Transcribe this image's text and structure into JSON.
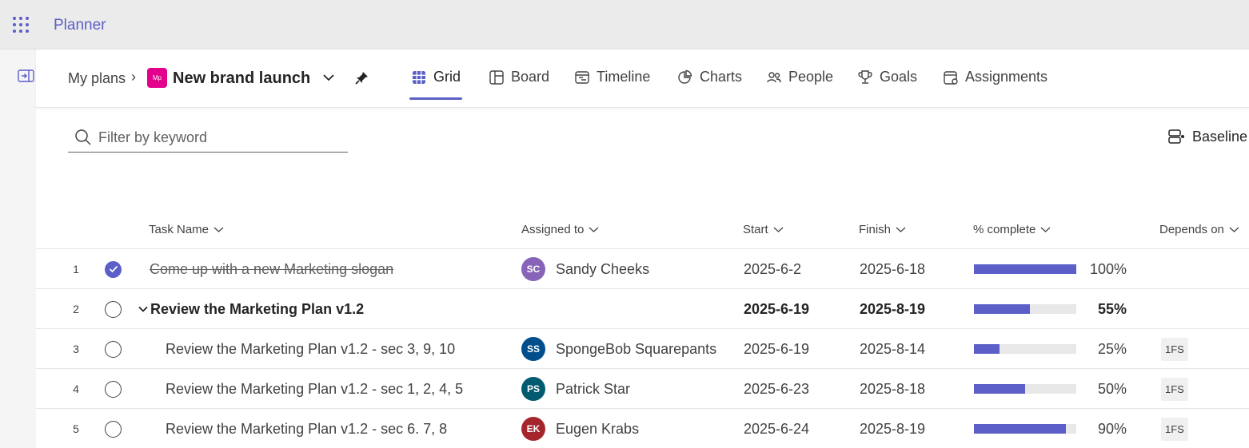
{
  "app": {
    "title": "Planner"
  },
  "breadcrumb": {
    "root": "My plans",
    "plan_badge": "Mp",
    "plan_name": "New brand launch"
  },
  "tabs": [
    {
      "label": "Grid",
      "icon": "grid-icon",
      "active": true
    },
    {
      "label": "Board",
      "icon": "board-icon",
      "active": false
    },
    {
      "label": "Timeline",
      "icon": "timeline-icon",
      "active": false
    },
    {
      "label": "Charts",
      "icon": "charts-icon",
      "active": false
    },
    {
      "label": "People",
      "icon": "people-icon",
      "active": false
    },
    {
      "label": "Goals",
      "icon": "trophy-icon",
      "active": false
    },
    {
      "label": "Assignments",
      "icon": "assignments-icon",
      "active": false
    }
  ],
  "filter": {
    "placeholder": "Filter by keyword"
  },
  "baseline": {
    "label": "Baseline"
  },
  "columns": {
    "task_name": "Task Name",
    "assigned_to": "Assigned to",
    "start": "Start",
    "finish": "Finish",
    "percent_complete": "% complete",
    "depends_on": "Depends on"
  },
  "colors": {
    "accent": "#5b5fc7",
    "plan_badge": "#e3008c"
  },
  "tasks": [
    {
      "num": "1",
      "name": "Come up with a new Marketing slogan",
      "completed": true,
      "summary": false,
      "assignee_initials": "SC",
      "assignee": "Sandy Cheeks",
      "avatar_color": "#8764b8",
      "start": "2025-6-2",
      "finish": "2025-6-18",
      "progress": 100,
      "percent": "100%",
      "depends": ""
    },
    {
      "num": "2",
      "name": "Review the Marketing Plan v1.2",
      "completed": false,
      "summary": true,
      "assignee_initials": "",
      "assignee": "",
      "avatar_color": "",
      "start": "2025-6-19",
      "finish": "2025-8-19",
      "progress": 55,
      "percent": "55%",
      "depends": ""
    },
    {
      "num": "3",
      "name": "Review the Marketing Plan v1.2 - sec 3, 9, 10",
      "completed": false,
      "summary": false,
      "assignee_initials": "SS",
      "assignee": "SpongeBob Squarepants",
      "avatar_color": "#004e8c",
      "start": "2025-6-19",
      "finish": "2025-8-14",
      "progress": 25,
      "percent": "25%",
      "depends": "1FS"
    },
    {
      "num": "4",
      "name": "Review the Marketing Plan v1.2 - sec 1, 2, 4, 5",
      "completed": false,
      "summary": false,
      "assignee_initials": "PS",
      "assignee": "Patrick Star",
      "avatar_color": "#005b70",
      "start": "2025-6-23",
      "finish": "2025-8-18",
      "progress": 50,
      "percent": "50%",
      "depends": "1FS"
    },
    {
      "num": "5",
      "name": "Review the Marketing Plan v1.2 - sec 6. 7, 8",
      "completed": false,
      "summary": false,
      "assignee_initials": "EK",
      "assignee": "Eugen Krabs",
      "avatar_color": "#a4262c",
      "start": "2025-6-24",
      "finish": "2025-8-19",
      "progress": 90,
      "percent": "90%",
      "depends": "1FS"
    }
  ]
}
